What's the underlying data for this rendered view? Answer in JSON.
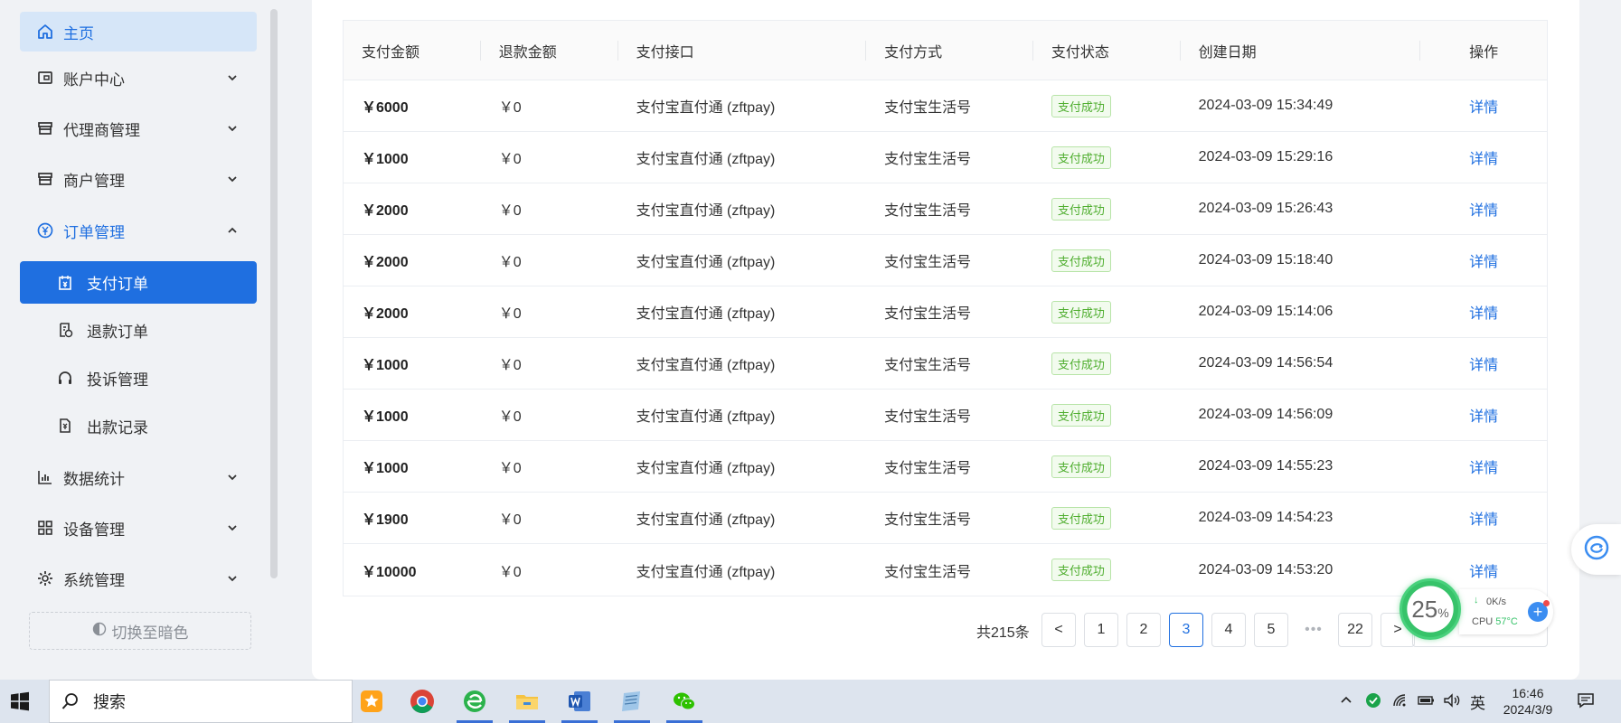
{
  "sidebar": {
    "home": "主页",
    "account": "账户中心",
    "agent": "代理商管理",
    "merchant": "商户管理",
    "orders": "订单管理",
    "pay_orders": "支付订单",
    "refund_orders": "退款订单",
    "complaints": "投诉管理",
    "payouts": "出款记录",
    "stats": "数据统计",
    "devices": "设备管理",
    "system": "系统管理",
    "theme_toggle": "切换至暗色"
  },
  "table": {
    "headers": [
      "支付金额",
      "退款金额",
      "支付接口",
      "支付方式",
      "支付状态",
      "创建日期",
      "操作"
    ],
    "rows": [
      {
        "amount": "￥6000",
        "refund": "￥0",
        "channel": "支付宝直付通 (zftpay)",
        "method": "支付宝生活号",
        "status": "支付成功",
        "date": "2024-03-09 15:34:49",
        "action": "详情"
      },
      {
        "amount": "￥1000",
        "refund": "￥0",
        "channel": "支付宝直付通 (zftpay)",
        "method": "支付宝生活号",
        "status": "支付成功",
        "date": "2024-03-09 15:29:16",
        "action": "详情"
      },
      {
        "amount": "￥2000",
        "refund": "￥0",
        "channel": "支付宝直付通 (zftpay)",
        "method": "支付宝生活号",
        "status": "支付成功",
        "date": "2024-03-09 15:26:43",
        "action": "详情"
      },
      {
        "amount": "￥2000",
        "refund": "￥0",
        "channel": "支付宝直付通 (zftpay)",
        "method": "支付宝生活号",
        "status": "支付成功",
        "date": "2024-03-09 15:18:40",
        "action": "详情"
      },
      {
        "amount": "￥2000",
        "refund": "￥0",
        "channel": "支付宝直付通 (zftpay)",
        "method": "支付宝生活号",
        "status": "支付成功",
        "date": "2024-03-09 15:14:06",
        "action": "详情"
      },
      {
        "amount": "￥1000",
        "refund": "￥0",
        "channel": "支付宝直付通 (zftpay)",
        "method": "支付宝生活号",
        "status": "支付成功",
        "date": "2024-03-09 14:56:54",
        "action": "详情"
      },
      {
        "amount": "￥1000",
        "refund": "￥0",
        "channel": "支付宝直付通 (zftpay)",
        "method": "支付宝生活号",
        "status": "支付成功",
        "date": "2024-03-09 14:56:09",
        "action": "详情"
      },
      {
        "amount": "￥1000",
        "refund": "￥0",
        "channel": "支付宝直付通 (zftpay)",
        "method": "支付宝生活号",
        "status": "支付成功",
        "date": "2024-03-09 14:55:23",
        "action": "详情"
      },
      {
        "amount": "￥1900",
        "refund": "￥0",
        "channel": "支付宝直付通 (zftpay)",
        "method": "支付宝生活号",
        "status": "支付成功",
        "date": "2024-03-09 14:54:23",
        "action": "详情"
      },
      {
        "amount": "￥10000",
        "refund": "￥0",
        "channel": "支付宝直付通 (zftpay)",
        "method": "支付宝生活号",
        "status": "支付成功",
        "date": "2024-03-09 14:53:20",
        "action": "详情"
      }
    ]
  },
  "pagination": {
    "total": "共215条",
    "prev": "<",
    "next": ">",
    "pages": [
      "1",
      "2",
      "3",
      "4",
      "5"
    ],
    "current": "3",
    "ellipsis": "•••",
    "last": "22"
  },
  "widget": {
    "percent": "25",
    "percent_unit": "%",
    "net_speed": "0K/s",
    "cpu_label": "CPU",
    "cpu_temp": "57°C",
    "plus": "+"
  },
  "taskbar": {
    "search_label": "搜索",
    "ime": "英",
    "time": "16:46",
    "date": "2024/3/9"
  },
  "colors": {
    "accent": "#1f6fe0",
    "success": "#4fae2f"
  }
}
